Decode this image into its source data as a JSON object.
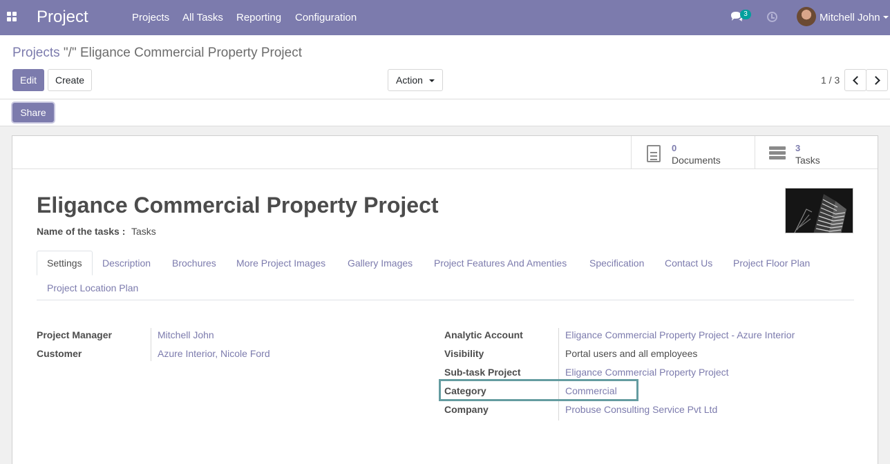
{
  "navbar": {
    "app_name": "Project",
    "menu": [
      "Projects",
      "All Tasks",
      "Reporting",
      "Configuration"
    ],
    "messages_count": "3",
    "user_name": "Mitchell John",
    "icons": [
      "apps-grid-icon",
      "chat-icon",
      "clock-icon",
      "user-avatar"
    ],
    "color": "#7c7bad"
  },
  "breadcrumb": {
    "parent": "Projects",
    "separator": "\"/\"",
    "current": "Eligance Commercial Property Project"
  },
  "toolbar": {
    "edit_label": "Edit",
    "create_label": "Create",
    "action_label": "Action",
    "share_label": "Share",
    "pager": "1 / 3"
  },
  "smart_buttons": [
    {
      "count": "0",
      "label": "Documents",
      "icon": "document-icon"
    },
    {
      "count": "3",
      "label": "Tasks",
      "icon": "tasks-icon"
    }
  ],
  "form": {
    "title": "Eligance Commercial Property Project",
    "tasks_name_label": "Name of the tasks :",
    "tasks_name_value": "Tasks",
    "tabs": [
      "Settings",
      "Description",
      "Brochures",
      "More Project Images",
      "Gallery Images",
      "Project Features And Amenties",
      "Specification",
      "Contact Us",
      "Project Floor Plan",
      "Project Location Plan"
    ],
    "active_tab": "Settings",
    "left_fields": [
      {
        "label": "Project Manager",
        "value": "Mitchell John"
      },
      {
        "label": "Customer",
        "value": "Azure Interior, Nicole Ford"
      }
    ],
    "right_fields": [
      {
        "label": "Analytic Account",
        "value": "Eligance Commercial Property Project - Azure Interior"
      },
      {
        "label": "Visibility",
        "value": "Portal users and all employees"
      },
      {
        "label": "Sub-task Project",
        "value": "Eligance Commercial Property Project"
      },
      {
        "label": "Category",
        "value": "Commercial"
      },
      {
        "label": "Company",
        "value": "Probuse Consulting Service Pvt Ltd"
      }
    ],
    "highlight_color": "#649ca0"
  }
}
